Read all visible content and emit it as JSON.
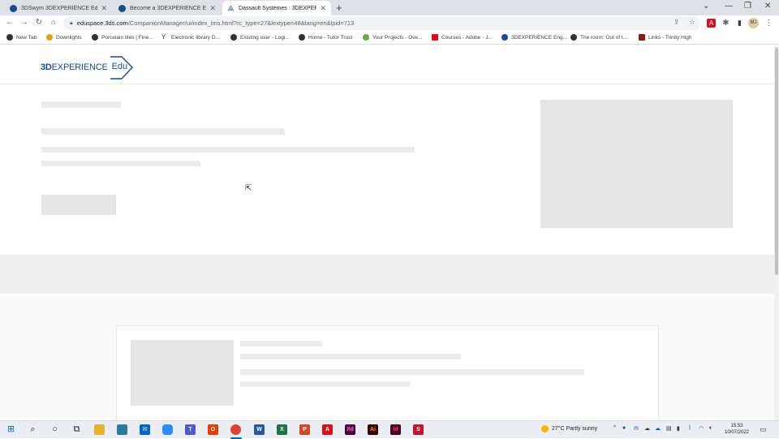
{
  "browser": {
    "tabs": [
      {
        "title": "3DSwym 3DEXPERIENCE Edu | Sl",
        "active": false
      },
      {
        "title": "Become a 3DEXPERIENCE Engine",
        "active": false
      },
      {
        "title": "Dassault Systèmes : 3DEXPERIEN",
        "active": true
      }
    ],
    "new_tab_glyph": "+",
    "url": "eduspace.3ds.com",
    "url_path": "/CompanionManager/ui/index_lms.html?rc_type=27&lextype=48&lang=en&lpid=713",
    "profile_initials": "MJ"
  },
  "bookmarks": [
    {
      "label": "New Tab",
      "icon": "globe-icon"
    },
    {
      "label": "Downlights",
      "icon": "bulb-icon"
    },
    {
      "label": "Porcelain tiles | Fine...",
      "icon": "tile-icon"
    },
    {
      "label": "Electronic library D...",
      "icon": "library-icon"
    },
    {
      "label": "Existing user - Logi...",
      "icon": "globe-icon"
    },
    {
      "label": "Home - Tutor Trust",
      "icon": "globe-icon"
    },
    {
      "label": "Your Projects - Ove...",
      "icon": "leaf-icon"
    },
    {
      "label": "Courses - Adobe - J...",
      "icon": "adobe-icon"
    },
    {
      "label": "3DEXPERIENCE Eng...",
      "icon": "globe-icon"
    },
    {
      "label": "The room: Out of t...",
      "icon": "room-icon"
    },
    {
      "label": "Links - Trinity High",
      "icon": "shield-icon"
    }
  ],
  "page": {
    "logo": {
      "brand_bold": "3D",
      "brand_rest": "EXPERIENCE",
      "sub": "Edu"
    }
  },
  "taskbar": {
    "weather": {
      "temp": "27°C",
      "condition": "Partly sunny"
    },
    "time": "15:53",
    "date": "10/07/2022",
    "colors": {
      "accent": "#0067c0",
      "word": "#2b579a",
      "excel": "#217346",
      "powerpoint": "#d24726",
      "acrobat": "#d4121f",
      "xd": "#470137",
      "illustrator": "#330000",
      "indesign": "#49021f"
    }
  }
}
